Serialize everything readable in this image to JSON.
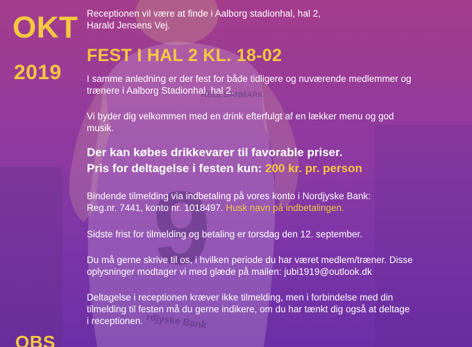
{
  "left": {
    "month": "OKT",
    "year": "2019",
    "bottom_partial": "OBS"
  },
  "reception": {
    "line1": "Receptionen vil være at finde i Aalborg stadionhal, hal 2,",
    "line2": "Harald Jensens Vej."
  },
  "fest_heading": "FEST I HAL 2 KL. 18-02",
  "para_occasion": {
    "line1": "I samme anledning er der fest for både tidligere og nuværende medlemmer og",
    "line2": "trænere i Aalborg Stadionhal, hal 2."
  },
  "para_welcome": {
    "line1": "Vi byder dig velkommen med en drink efterfulgt af en lækker menu og god",
    "line2": "musik."
  },
  "drinks": {
    "line1": "Der kan købes drikkevarer til favorable priser.",
    "line2_prefix": "Pris for deltagelse i festen kun:",
    "price": "200 kr. pr. person"
  },
  "registration": {
    "line1": "Bindende tilmelding via indbetaling på vores konto i Nordjyske Bank:",
    "line2_prefix": "Reg.nr. 7441, konto nr. 1018497.",
    "line2_highlight": "Husk navn på indbetalingen."
  },
  "deadline": "Sidste frist for tilmelding og betaling er torsdag den 12. september.",
  "period": {
    "line1": "Du må gerne skrive til os, i hvilken periode du har været medlem/træner. Disse",
    "line2": "oplysninger modtager vi med glæde på mailen: jubi1919@outlook.dk"
  },
  "participation": {
    "line1": "Deltagelse i receptionen kræver ikke tilmelding, men i forbindelse med din",
    "line2": "tilmelding til festen må du gerne indikere, om du har tænkt dig også at deltage",
    "line3": "i receptionen."
  },
  "photo_text": {
    "sponsor1": "HELE DANMARK",
    "sponsor2": "rdjyske Bank"
  },
  "colors": {
    "accent_yellow": "#f5c842",
    "bg_top": "#a53c8c",
    "bg_bottom": "#6c2fa6"
  }
}
